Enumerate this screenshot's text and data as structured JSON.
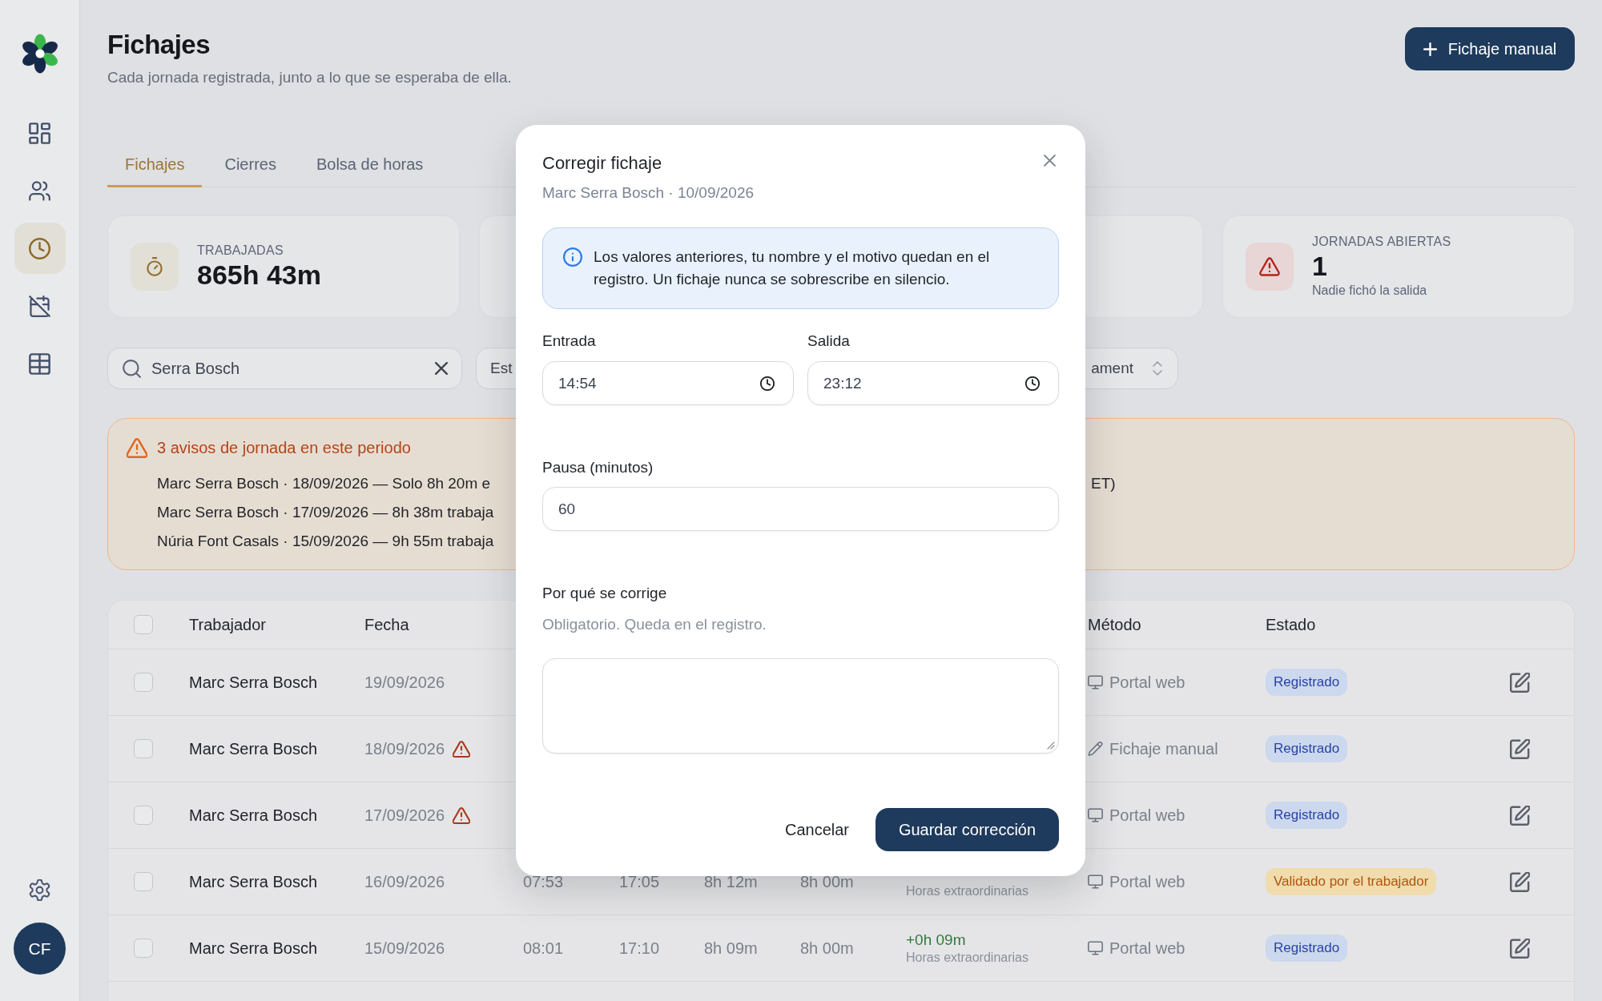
{
  "sidebar": {
    "items": [
      {
        "kind": "dashboard",
        "selected": false
      },
      {
        "kind": "people",
        "selected": false
      },
      {
        "kind": "clock",
        "selected": true
      },
      {
        "kind": "calendar",
        "selected": false
      },
      {
        "kind": "table",
        "selected": false
      }
    ],
    "avatar": "CF"
  },
  "header": {
    "title": "Fichajes",
    "subtitle": "Cada jornada registrada, junto a lo que se esperaba de ella.",
    "action": "Fichaje manual"
  },
  "tabs": [
    {
      "label": "Fichajes",
      "selected": true
    },
    {
      "label": "Cierres",
      "selected": false
    },
    {
      "label": "Bolsa de horas",
      "selected": false
    }
  ],
  "stats": [
    {
      "kind": "timer",
      "label": "TRABAJADAS",
      "value": "865h 43m"
    },
    {
      "kind": "covered"
    },
    {
      "kind": "covered"
    },
    {
      "kind": "alert",
      "label": "JORNADAS ABIERTAS",
      "value": "1",
      "note": "Nadie fichó la salida"
    }
  ],
  "filters": {
    "search": {
      "value": "Serra Bosch"
    },
    "selects": [
      {
        "kind": "field",
        "value": "Est"
      },
      {
        "kind": "dropdown",
        "value": "ament"
      }
    ]
  },
  "warnings": {
    "title": "3 avisos de jornada en este periodo",
    "items": [
      {
        "text": "Marc Serra Bosch · 18/09/2026 — Solo 8h 20m e",
        "tail": "ET)"
      },
      {
        "text": "Marc Serra Bosch · 17/09/2026 — 8h 38m trabaja"
      },
      {
        "text": "Núria Font Casals · 15/09/2026 — 9h 55m trabaja"
      }
    ]
  },
  "table": {
    "header": {
      "checked": false,
      "worker": "Trabajador",
      "date": "Fecha",
      "method": "Método",
      "status": "Estado"
    },
    "rows": [
      {
        "checked": false,
        "worker": "Marc Serra Bosch",
        "date": "19/09/2026",
        "warning": false,
        "method": {
          "kind": "web",
          "label": "Portal web"
        },
        "status": {
          "kind": "registered",
          "label": "Registrado"
        }
      },
      {
        "checked": false,
        "worker": "Marc Serra Bosch",
        "date": "18/09/2026",
        "warning": true,
        "method": {
          "kind": "manual",
          "label": "Fichaje manual"
        },
        "status": {
          "kind": "registered",
          "label": "Registrado"
        }
      },
      {
        "checked": false,
        "worker": "Marc Serra Bosch",
        "date": "17/09/2026",
        "warning": true,
        "method": {
          "kind": "web",
          "label": "Portal web"
        },
        "status": {
          "kind": "registered",
          "label": "Registrado"
        }
      },
      {
        "checked": false,
        "worker": "Marc Serra Bosch",
        "date": "16/09/2026",
        "warning": false,
        "column_3": "07:53",
        "column_4": "17:05",
        "column_5": "8h 12m",
        "column_6": "8h 00m",
        "column_7": {
          "note": "Horas extraordinarias"
        },
        "method": {
          "kind": "web",
          "label": "Portal web"
        },
        "status": {
          "kind": "validated",
          "label": "Validado por el trabajador"
        }
      },
      {
        "checked": false,
        "worker": "Marc Serra Bosch",
        "date": "15/09/2026",
        "warning": false,
        "column_3": "08:01",
        "column_4": "17:10",
        "column_5": "8h 09m",
        "column_6": "8h 00m",
        "column_7": {
          "kind": "positive",
          "value": "+0h 09m",
          "note": "Horas extraordinarias"
        },
        "method": {
          "kind": "web",
          "label": "Portal web"
        },
        "status": {
          "kind": "registered",
          "label": "Registrado"
        }
      }
    ]
  },
  "dialog": {
    "title": "Corregir fichaje",
    "subtitle": "Marc Serra Bosch · 10/09/2026",
    "notice": "Los valores anteriores, tu nombre y el motivo quedan en el registro. Un fichaje nunca se sobrescribe en silencio.",
    "times": [
      {
        "label": "Entrada",
        "value": "14:54"
      },
      {
        "label": "Salida",
        "value": "23:12"
      }
    ],
    "pause": {
      "label": "Pausa (minutos)",
      "value": "60"
    },
    "reason": {
      "label": "Por qué se corrige",
      "hint": "Obligatorio. Queda en el registro."
    },
    "buttons": [
      {
        "kind": "secondary",
        "label": "Cancelar"
      },
      {
        "kind": "primary",
        "label": "Guardar corrección"
      }
    ]
  }
}
